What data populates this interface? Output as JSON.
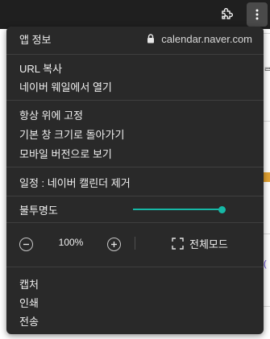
{
  "menu": {
    "app_info_label": "앱 정보",
    "site_domain": "calendar.naver.com",
    "copy_url": "URL 복사",
    "open_in_naver_whale": "네이버 웨일에서 열기",
    "always_on_top": "항상 위에 고정",
    "restore_window_size": "기본 창 크기로 돌아가기",
    "view_mobile": "모바일 버전으로 보기",
    "remove_app": "일정 : 네이버 캘린더 제거",
    "opacity_label": "불투명도",
    "opacity_value": 1.0,
    "zoom_level": "100%",
    "fullscreen_label": "전체모드",
    "capture": "캡처",
    "print": "인쇄",
    "send": "전송"
  },
  "colors": {
    "menu_bg": "#292929",
    "titlebar_bg": "#1f1f1f",
    "accent": "#16b8a6"
  },
  "icons": {
    "extensions": "puzzle-icon",
    "more": "more-vertical-icon",
    "lock": "lock-icon",
    "zoom_out": "minus-icon",
    "zoom_in": "plus-icon",
    "fullscreen": "fullscreen-icon"
  }
}
